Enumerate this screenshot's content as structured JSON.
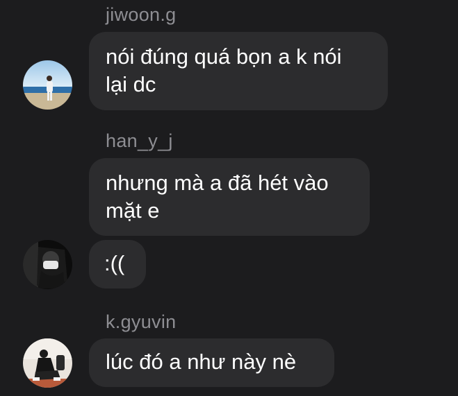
{
  "messages": [
    {
      "username": "jiwoon.g",
      "bubbles": [
        "nói đúng quá bọn a k nói\nlại dc"
      ],
      "avatar_icon": "avatar-beach-photo"
    },
    {
      "username": "han_y_j",
      "bubbles": [
        "nhưng mà a đã hét vào\nmặt e",
        ":(("
      ],
      "avatar_icon": "avatar-masked-person-photo"
    },
    {
      "username": "k.gyuvin",
      "bubbles": [
        "lúc đó a như này nè"
      ],
      "avatar_icon": "avatar-sitting-person-photo"
    }
  ],
  "colors": {
    "background": "#1c1c1e",
    "bubble": "#2c2c2e",
    "username": "#8e8e93",
    "text": "#ffffff"
  }
}
